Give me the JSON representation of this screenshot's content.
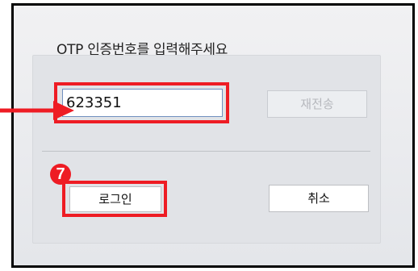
{
  "dialog": {
    "prompt": "OTP 인증번호를 입력해주세요",
    "otp_value": "623351",
    "resend_label": "재전송",
    "login_label": "로그인",
    "cancel_label": "취소"
  },
  "annotation": {
    "step_number": "7",
    "highlight_color": "#ee1c24"
  }
}
